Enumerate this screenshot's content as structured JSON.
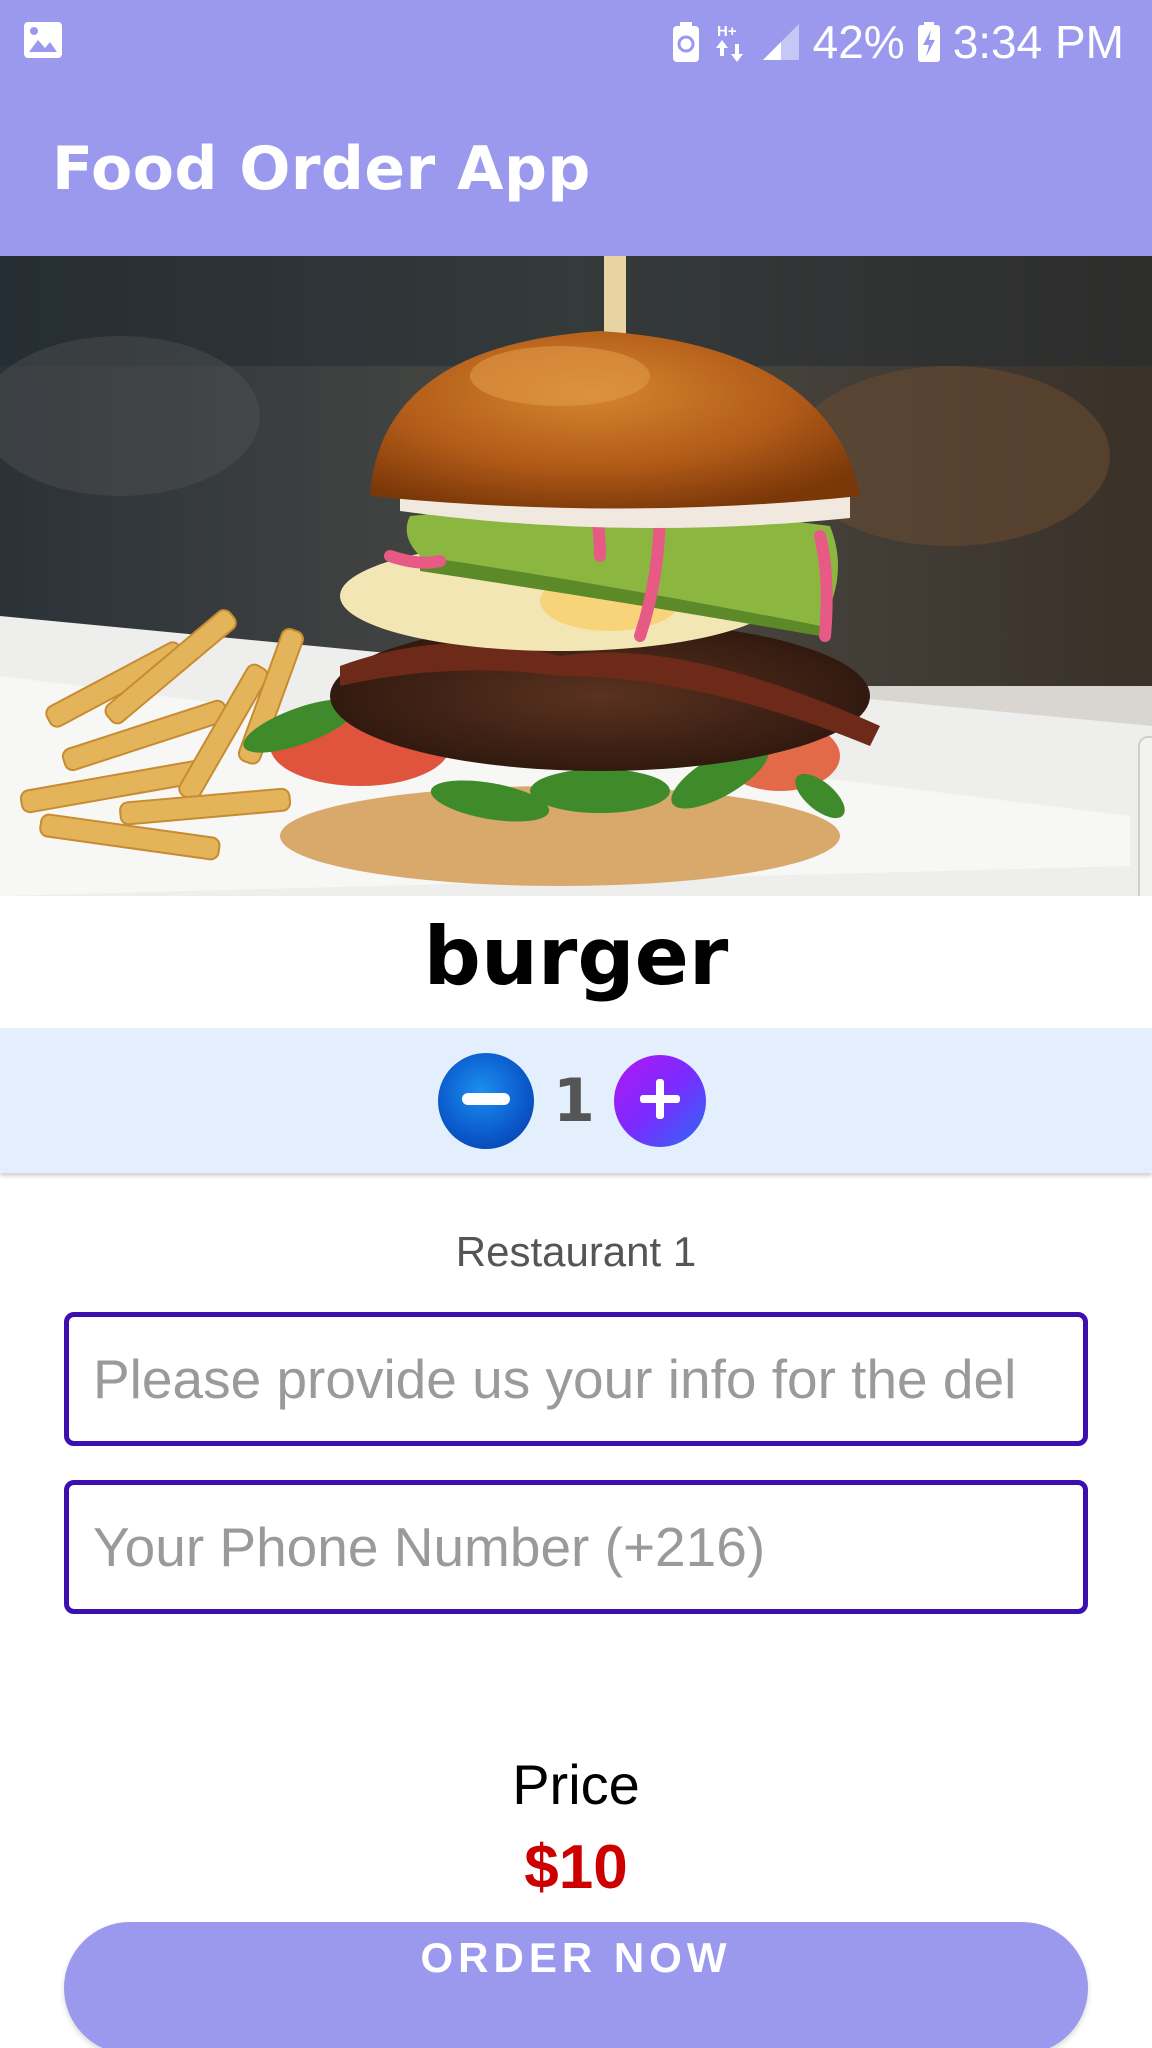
{
  "status_bar": {
    "battery_percent": "42%",
    "time": "3:34 PM",
    "network": "H+",
    "icons": [
      "image-notification-icon",
      "battery-saver-icon",
      "data-arrows-icon",
      "signal-icon",
      "battery-charging-icon"
    ]
  },
  "app_bar": {
    "title": "Food Order App",
    "color": "#9a99ee"
  },
  "food": {
    "name": "burger",
    "image_subject": "burger-with-fries-photo"
  },
  "quantity": {
    "value": "1",
    "decrement_icon": "minus-icon",
    "increment_icon": "plus-icon"
  },
  "restaurant": {
    "name": "Restaurant 1"
  },
  "form": {
    "address_placeholder": "Please provide us your info for the del",
    "address_value": "",
    "phone_placeholder": "Your Phone Number (+216)",
    "phone_value": "",
    "border_color": "#3c0fb0"
  },
  "price": {
    "label": "Price",
    "value": "$10",
    "color": "#cc0000"
  },
  "actions": {
    "order_label": "ORDER NOW"
  }
}
